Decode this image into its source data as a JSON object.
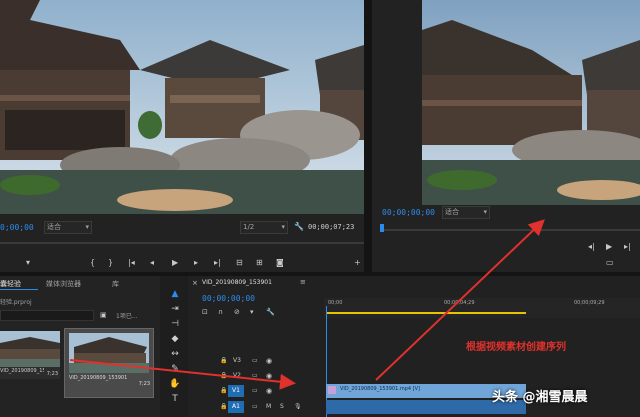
{
  "source_monitor": {
    "timecode_left": "0;00;00",
    "fit_label": "适合",
    "fraction": "1/2",
    "timecode_right": "00;00;07;23",
    "transport_icons": [
      "marker-icon",
      "in-point-icon",
      "out-point-icon",
      "go-to-in-icon",
      "step-back-icon",
      "play-icon",
      "step-forward-icon",
      "insert-icon",
      "overwrite-icon",
      "export-frame-icon",
      "add-button-icon"
    ]
  },
  "program_monitor": {
    "timecode": "00;00;00;00",
    "fit_label": "适合"
  },
  "project_panel": {
    "tab_active": "囊轻验",
    "tab_media": "媒体浏览器",
    "tab_library": "库",
    "project_file": "轻验.prproj",
    "item_count": "1项已...",
    "clips": [
      {
        "name": "VID_20190809_15390...",
        "duration": "7;23"
      },
      {
        "name": "VID_20190809_153901",
        "duration": "7;23"
      }
    ]
  },
  "timeline": {
    "sequence_tab": "VID_20190809_153901",
    "timecode": "00;00;00;00",
    "ruler": [
      "00;00",
      "00;00;04;29",
      "00;00;09;29"
    ],
    "tracks": [
      {
        "label": "V3"
      },
      {
        "label": "V2"
      },
      {
        "label": "V1"
      },
      {
        "label": "A1"
      }
    ],
    "video_clip_label": "VID_20190809_153901.mp4 [V]",
    "audio_track_letters": [
      "M",
      "S"
    ]
  },
  "annotation": {
    "text": "根据视频素材创建序列",
    "color": "#e0312c"
  },
  "watermark": {
    "text": "头条 @湘雪晨晨"
  },
  "colors": {
    "accent_blue": "#2d8ceb",
    "clip_blue": "#6fa5d8",
    "annotation_red": "#e0312c",
    "playhead_yellow": "#e8c400"
  }
}
